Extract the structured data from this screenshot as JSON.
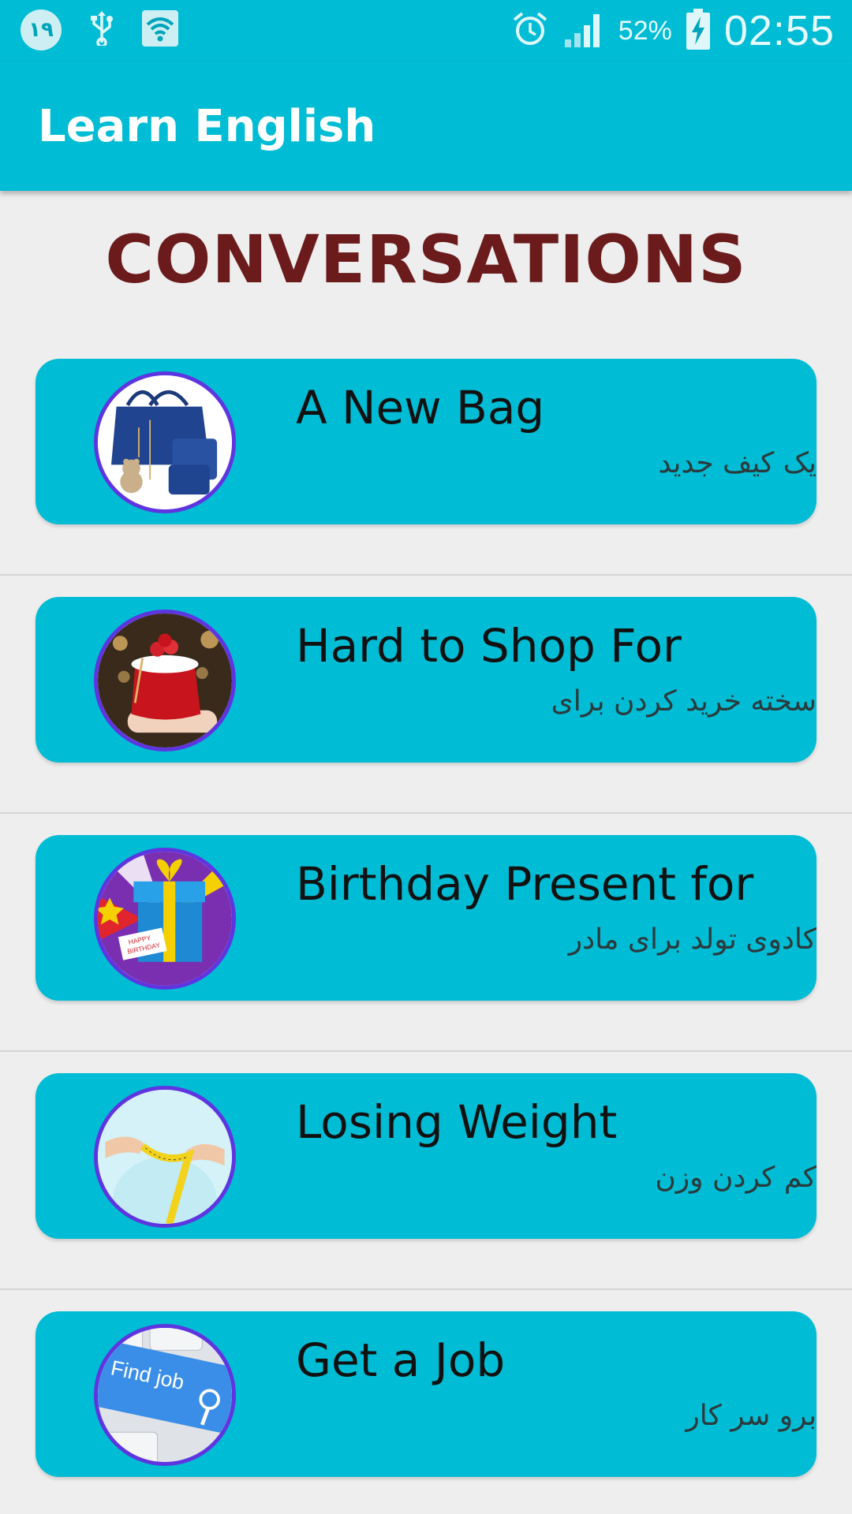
{
  "status_bar": {
    "notification_badge": "۱۹",
    "icons": [
      "notification-badge-icon",
      "usb-icon",
      "wifi-icon",
      "alarm-icon",
      "signal-icon",
      "battery-charging-icon"
    ],
    "battery_percent": "52%",
    "time": "02:55"
  },
  "app_bar": {
    "title": "Learn English"
  },
  "heading": "CONVERSATIONS",
  "colors": {
    "primary": "#00bcd4",
    "heading": "#6b1b1b",
    "thumb_border": "#5e35e0",
    "background": "#eeeeee"
  },
  "items": [
    {
      "title": "A New Bag",
      "subtitle": "یک کیف جدید",
      "image": "handbag-image"
    },
    {
      "title": "Hard to Shop For",
      "subtitle": "سخته خرید کردن برای",
      "image": "gift-bag-image"
    },
    {
      "title": "Birthday Present for",
      "subtitle": "کادوی تولد برای مادر",
      "image": "birthday-gift-image",
      "image_text": [
        "HAPPY",
        "BIRTHDAY"
      ]
    },
    {
      "title": "Losing Weight",
      "subtitle": "کم کردن وزن",
      "image": "measuring-tape-image"
    },
    {
      "title": "Get a Job",
      "subtitle": "برو سر کار",
      "image": "find-job-key-image",
      "image_text": [
        "Find job"
      ]
    }
  ]
}
